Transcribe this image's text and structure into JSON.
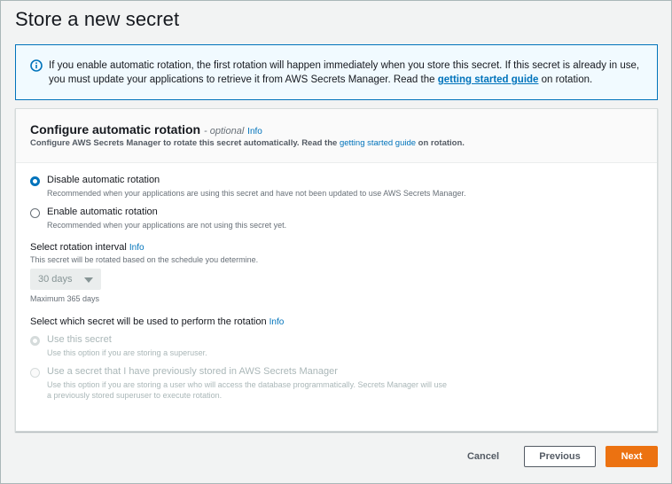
{
  "page": {
    "title": "Store a new secret"
  },
  "alert": {
    "icon": "info-circle-icon",
    "text_before": "If you enable automatic rotation, the first rotation will happen immediately when you store this secret. If this secret is already in use, you must update your applications to retrieve it from AWS Secrets Manager. Read the ",
    "link": "getting started guide",
    "text_after": " on rotation."
  },
  "panel": {
    "title": "Configure automatic rotation",
    "optional": " - optional",
    "info": "Info",
    "desc_before": "Configure AWS Secrets Manager to rotate this secret automatically. Read the ",
    "desc_link": "getting started guide",
    "desc_after": " on rotation."
  },
  "rotation_options": [
    {
      "label": "Disable automatic rotation",
      "desc": "Recommended when your applications are using this secret and have not been updated to use AWS Secrets Manager.",
      "selected": true
    },
    {
      "label": "Enable automatic rotation",
      "desc": "Recommended when your applications are not using this secret yet.",
      "selected": false
    }
  ],
  "interval": {
    "label": "Select rotation interval",
    "info": "Info",
    "desc": "This secret will be rotated based on the schedule you determine.",
    "value": "30 days",
    "constraint": "Maximum 365 days"
  },
  "secret_choice": {
    "label": "Select which secret will be used to perform the rotation",
    "info": "Info",
    "options": [
      {
        "label": "Use this secret",
        "desc": "Use this option if you are storing a superuser.",
        "selected": true,
        "disabled": true
      },
      {
        "label": "Use a secret that I have previously stored in AWS Secrets Manager",
        "desc_line1": "Use this option if you are storing a user who will access the database programmatically. Secrets Manager will use",
        "desc_line2": "a previously stored superuser to execute rotation.",
        "selected": false,
        "disabled": true
      }
    ]
  },
  "footer": {
    "cancel": "Cancel",
    "previous": "Previous",
    "next": "Next"
  },
  "colors": {
    "link": "#0073bb",
    "primary_button": "#ec7211",
    "alert_bg": "#f1faff"
  }
}
